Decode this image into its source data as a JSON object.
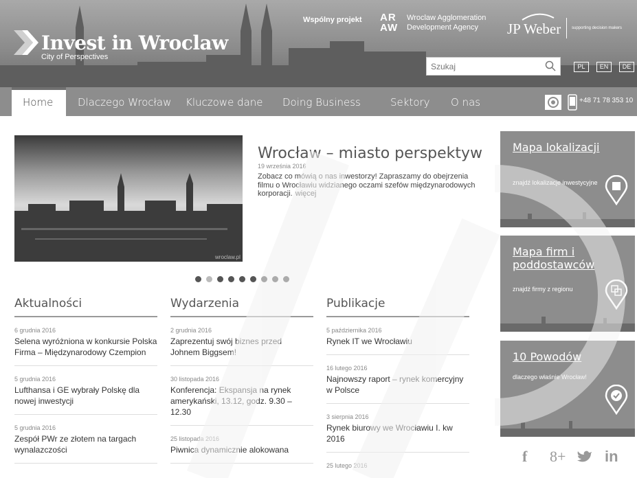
{
  "header": {
    "logo_title": "Invest in Wroclaw",
    "logo_subtitle": "City of Perspectives",
    "joint_project": "Wspólny projekt",
    "araw_top": "AR",
    "araw_bottom": "AW",
    "araw_line1": "Wroclaw Agglomeration",
    "araw_line2": "Development Agency",
    "jpweber": "JP Weber",
    "jpweber_tag": "supporting decision makers",
    "search_placeholder": "Szukaj",
    "languages": [
      "PL",
      "EN",
      "DE"
    ]
  },
  "nav": {
    "items": [
      "Home",
      "Dlaczego Wrocław",
      "Kluczowe dane",
      "Doing Business",
      "Sektory",
      "O nas"
    ],
    "active": "Home",
    "phone": "+48 71 78 353 10"
  },
  "slider": {
    "title": "Wrocław – miasto perspektyw",
    "date": "19 września 2016",
    "text": "Zobacz co mówią o nas inwestorzy! Zapraszamy do obejrzenia filmu o Wrocławiu widzianego oczami szefów międzynarodowych korporacji.",
    "more": "więcej",
    "image_caption": "wroclaw.pl",
    "dot_count": 9,
    "active_dot": 2
  },
  "news": {
    "heading": "Aktualności",
    "items": [
      {
        "date": "6 grudnia 2016",
        "title": "Selena wyróżniona w konkursie Polska Firma – Międzynarodowy Czempion"
      },
      {
        "date": "5 grudnia 2016",
        "title": "Lufthansa i GE wybrały Polskę dla nowej inwestycji"
      },
      {
        "date": "5 grudnia 2016",
        "title": "Zespół PWr ze złotem na targach wynalazczości"
      }
    ]
  },
  "events": {
    "heading": "Wydarzenia",
    "items": [
      {
        "date": "2 grudnia 2016",
        "title": "Zaprezentuj swój biznes przed Johnem Biggsem!"
      },
      {
        "date": "30 listopada 2016",
        "title": "Konferencja: Ekspansja na rynek amerykański, 13.12, godz. 9.30 – 12.30"
      },
      {
        "date": "25 listopada 2016",
        "title": "Piwnica dynamicznie alokowana"
      }
    ]
  },
  "publications": {
    "heading": "Publikacje",
    "items": [
      {
        "date": "5 października 2016",
        "title": "Rynek IT we Wrocławiu"
      },
      {
        "date": "16 lutego 2016",
        "title": "Najnowszy raport – rynek komercyjny w Polsce"
      },
      {
        "date": "3 sierpnia 2016",
        "title": "Rynek biurowy we Wrocławiu I. kw 2016"
      },
      {
        "date": "25 lutego 2016",
        "title": ""
      }
    ]
  },
  "sidebar": {
    "boxes": [
      {
        "title": "Mapa lokalizacji",
        "subtitle": "znajdź lokalizacje inwestycyjne"
      },
      {
        "title": "Mapa firm i poddostawców",
        "subtitle": "znajdź firmy z regionu"
      },
      {
        "title": "10 Powodów",
        "subtitle": "dlaczego właśnie Wrocław!"
      }
    ],
    "social": [
      "f",
      "8+",
      "twitter",
      "in"
    ]
  }
}
